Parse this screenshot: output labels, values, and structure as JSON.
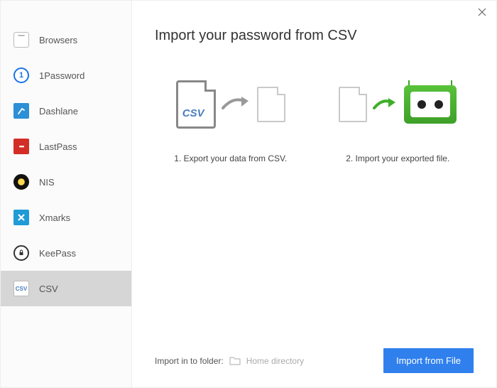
{
  "sidebar": {
    "items": [
      {
        "id": "browsers",
        "label": "Browsers"
      },
      {
        "id": "1password",
        "label": "1Password"
      },
      {
        "id": "dashlane",
        "label": "Dashlane"
      },
      {
        "id": "lastpass",
        "label": "LastPass"
      },
      {
        "id": "nis",
        "label": "NIS"
      },
      {
        "id": "xmarks",
        "label": "Xmarks"
      },
      {
        "id": "keepass",
        "label": "KeePass"
      },
      {
        "id": "csv",
        "label": "CSV"
      }
    ],
    "active_id": "csv"
  },
  "main": {
    "title": "Import your password from CSV",
    "step1_text": "1. Export your data from CSV.",
    "step2_text": "2. Import your exported file.",
    "csv_icon_label": "CSV"
  },
  "footer": {
    "folder_label": "Import in to folder:",
    "folder_value": "Home directory",
    "import_button": "Import from File"
  }
}
